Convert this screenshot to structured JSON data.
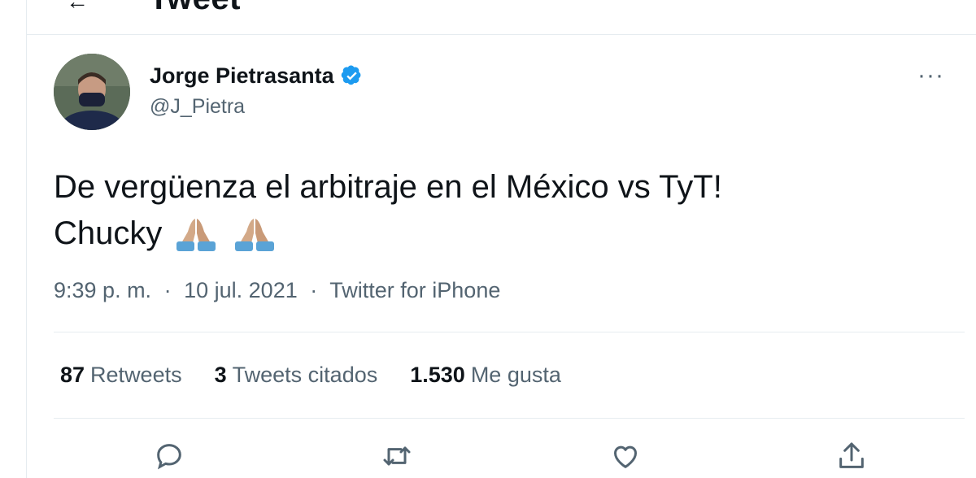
{
  "header": {
    "title": "Tweet",
    "back_label": "←"
  },
  "author": {
    "name": "Jorge Pietrasanta",
    "handle": "@J_Pietra",
    "verified": true,
    "verified_color": "#1d9bf0"
  },
  "more_label": "···",
  "tweet": {
    "line1": "De vergüenza el arbitraje en el México vs TyT!",
    "line2": "Chucky",
    "emojis": [
      "folded-hands-emoji",
      "folded-hands-emoji"
    ]
  },
  "meta": {
    "time": "9:39 p. m.",
    "separator": "·",
    "date": "10 jul. 2021",
    "source": "Twitter for iPhone"
  },
  "stats": {
    "retweets_count": "87",
    "retweets_label": "Retweets",
    "quotes_count": "3",
    "quotes_label": "Tweets citados",
    "likes_count": "1.530",
    "likes_label": "Me gusta"
  },
  "actions": [
    "reply-icon",
    "retweet-icon",
    "like-icon",
    "share-icon"
  ],
  "colors": {
    "secondary_text": "#536471",
    "primary_text": "#0f1419",
    "border": "#e6ecf0"
  }
}
